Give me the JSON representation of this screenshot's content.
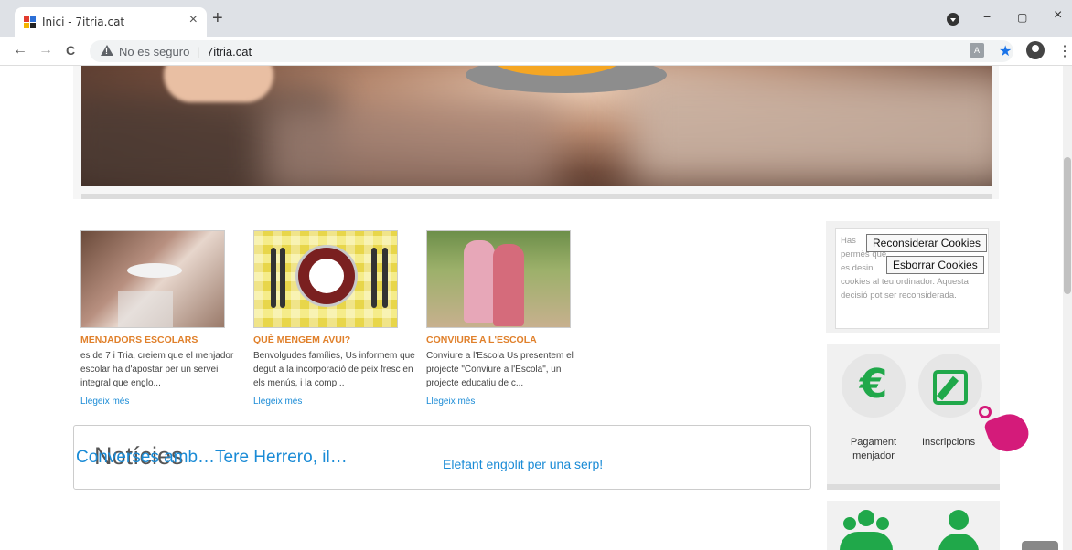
{
  "browser": {
    "tab_title": "Inici - 7itria.cat",
    "tab_close": "×",
    "new_tab": "+",
    "security_label": "No es seguro",
    "url_separator": "|",
    "url_host": "7itria.cat",
    "back": "←",
    "forward": "→",
    "reload": "C",
    "minimize": "−",
    "maximize": "▢",
    "close": "×",
    "star": "★",
    "menu": "⋮",
    "translate": "A"
  },
  "cards": [
    {
      "title": "MENJADORS ESCOLARS",
      "text": "es de 7 i Tria, creiem que el menjador escolar ha d'apostar per un servei integral que englo...",
      "link": "Llegeix més"
    },
    {
      "title": "QUÈ MENGEM AVUI?",
      "text": "Benvolgudes famílies, Us informem que degut a la incorporació de peix fresc en els menús, i la comp...",
      "link": "Llegeix més"
    },
    {
      "title": "CONVIURE A L'ESCOLA",
      "text": "Conviure a l'Escola   Us presentem el projecte \"Conviure a l'Escola\", un projecte educatiu de c...",
      "link": "Llegeix més"
    }
  ],
  "news": {
    "title": "Notícies",
    "item1": "Converses amb…Tere Herrero, il…",
    "item2": "Elefant engolit per una serp!"
  },
  "cookies": {
    "text_has": "Has",
    "text_permes": "permès que",
    "text_desin": "es desin",
    "text_rest": "cookies al teu ordinador. Aquesta decisió pot ser reconsiderada.",
    "btn_reconsider": "Reconsiderar Cookies",
    "btn_delete": "Esborrar Cookies"
  },
  "quick_links": {
    "payment_label": "Pagament menjador",
    "inscriptions_label": "Inscripcions",
    "euro_symbol": "€"
  },
  "colors": {
    "accent_orange": "#e0802b",
    "link_blue": "#1a8bd6",
    "icon_green": "#20a84a",
    "cursor_magenta": "#d41b7a"
  }
}
